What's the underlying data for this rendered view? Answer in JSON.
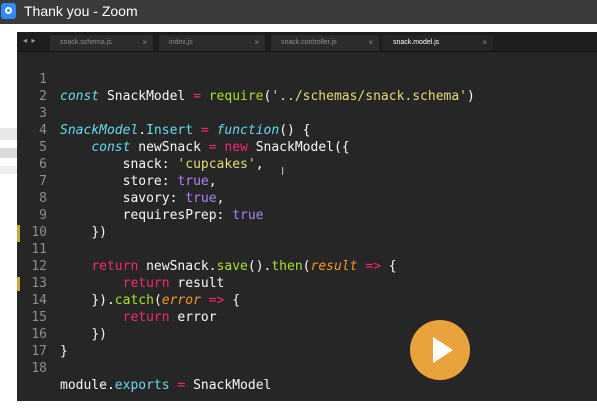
{
  "window": {
    "title": "Thank you - Zoom",
    "icon": "zoom-icon"
  },
  "tabs": [
    {
      "label": "snack.schema.js",
      "close": "×",
      "active": false
    },
    {
      "label": "index.js",
      "close": "×",
      "active": false
    },
    {
      "label": "snack.controller.js",
      "close": "×",
      "active": false
    },
    {
      "label": "snack.model.js",
      "close": "×",
      "active": true
    }
  ],
  "tab_nav": "◂ ▸",
  "code": {
    "line_numbers": [
      "1",
      "2",
      "3",
      "4",
      "5",
      "6",
      "7",
      "8",
      "9",
      "10",
      "11",
      "12",
      "13",
      "14",
      "15",
      "16",
      "17",
      "18"
    ],
    "l1": {
      "kw": "const",
      "name": " SnackModel ",
      "op": "=",
      "sp": " ",
      "fn": "require",
      "p1": "(",
      "str": "'../schemas/snack.schema'",
      "p2": ")"
    },
    "l3": {
      "cls": "SnackModel",
      "dot": ".",
      "prop": "Insert",
      "sp": " ",
      "op": "=",
      "sp2": " ",
      "kw": "function",
      "rest": "() {"
    },
    "l4": {
      "indent": "    ",
      "kw": "const",
      "name": " newSnack ",
      "op": "=",
      "sp": " ",
      "kw2": "new",
      "rest": " SnackModel({"
    },
    "l5": {
      "indent": "        ",
      "key": "snack: ",
      "str": "'cupcakes'",
      "rest": ","
    },
    "l6": {
      "indent": "        ",
      "key": "store: ",
      "bool": "true",
      "rest": ","
    },
    "l7": {
      "indent": "        ",
      "key": "savory: ",
      "bool": "true",
      "rest": ","
    },
    "l8": {
      "indent": "        ",
      "key": "requiresPrep: ",
      "bool": "true"
    },
    "l9": {
      "indent": "    ",
      "rest": "})"
    },
    "l11": {
      "indent": "    ",
      "ret": "return",
      "name": " newSnack.",
      "fn": "save",
      "p1": "().",
      "fn2": "then",
      "p2": "(",
      "param": "result",
      "sp": " ",
      "op": "=>",
      "rest": " {"
    },
    "l12": {
      "indent": "        ",
      "ret": "return",
      "rest": " result"
    },
    "l13": {
      "indent": "    ",
      "p1": "}).",
      "fn": "catch",
      "p2": "(",
      "param": "error",
      "sp": " ",
      "op": "=>",
      "rest": " {"
    },
    "l14": {
      "indent": "        ",
      "ret": "return",
      "rest": " error"
    },
    "l15": {
      "indent": "    ",
      "rest": "})"
    },
    "l16": {
      "rest": "}"
    },
    "l18": {
      "name": "module",
      "dot": ".",
      "prop": "exports",
      "sp": " ",
      "op": "=",
      "rest": " SnackModel"
    }
  },
  "colors": {
    "editor_bg": "#262626",
    "titlebar_bg": "#3a3a3a",
    "play_button": "#e8a33a",
    "modified_marker": "#c9a83a"
  },
  "icons": {
    "play": "play-icon",
    "cursor": "text-cursor-icon",
    "close": "close-icon"
  },
  "cursor_glyph": "I"
}
